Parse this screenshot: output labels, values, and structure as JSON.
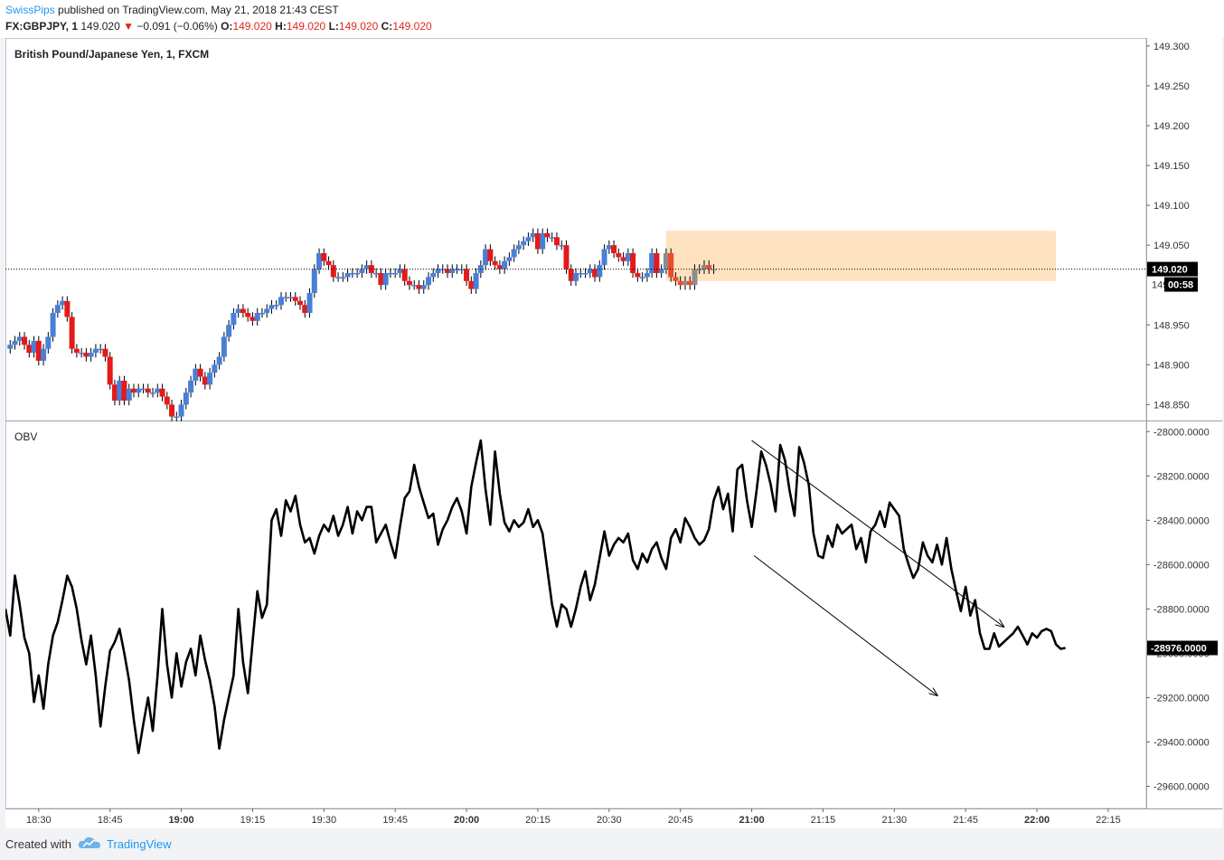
{
  "header": {
    "publisher": "SwissPips",
    "published_text": " published on TradingView.com, May 21, 2018 21:43 CEST",
    "symbol": "FX:GBPJPY, 1",
    "last": "149.020",
    "change": "−0.091 (−0.06%)",
    "o_label": "O:",
    "o_value": "149.020",
    "h_label": "H:",
    "h_value": "149.020",
    "l_label": "L:",
    "l_value": "149.020",
    "c_label": "C:",
    "c_value": "149.020"
  },
  "footer": {
    "created_with": "Created with",
    "brand": "TradingView"
  },
  "colors": {
    "up": "#4a7fd6",
    "down": "#e41a1c",
    "gray": "#8c8c8c",
    "highlight": "#ffe2bf",
    "grid": "#e0e3eb",
    "line": "#000000",
    "price_label_bg": "#000000"
  },
  "chart_data": [
    {
      "type": "candlestick",
      "title": "British Pound/Japanese Yen, 1, FXCM",
      "ylim": [
        148.83,
        149.31
      ],
      "y_ticks": [
        "149.300",
        "149.250",
        "149.200",
        "149.150",
        "149.100",
        "149.050",
        "148.950",
        "148.900",
        "148.850"
      ],
      "y_tick_values": [
        149.3,
        149.25,
        149.2,
        149.15,
        149.1,
        149.05,
        148.95,
        148.9,
        148.85
      ],
      "x_ticks": [
        "18:30",
        "18:45",
        "19:00",
        "19:15",
        "19:30",
        "19:45",
        "20:00",
        "20:15",
        "20:30",
        "20:45",
        "21:00",
        "21:15",
        "21:30",
        "21:45",
        "22:00",
        "22:15"
      ],
      "x_tick_minutes": [
        0,
        15,
        30,
        45,
        60,
        75,
        90,
        105,
        120,
        135,
        150,
        165,
        180,
        195,
        210,
        225
      ],
      "bold_ticks": [
        "19:00",
        "20:00",
        "21:00",
        "22:00"
      ],
      "x_start_minute": -7,
      "x_end_minute": 233,
      "candles_start_minute": -6,
      "current_price": 149.02,
      "current_price_label": "149.020",
      "countdown_label": "00:58",
      "countdown_covered_tick": "149.000",
      "highlight_zone": {
        "from_minute": 132,
        "to_minute": 233,
        "low": 149.005,
        "high": 149.068
      },
      "closes": [
        148.925,
        148.93,
        148.935,
        148.925,
        148.915,
        148.93,
        148.905,
        148.92,
        148.935,
        148.965,
        148.975,
        148.98,
        148.96,
        148.92,
        148.915,
        148.915,
        148.91,
        148.915,
        148.92,
        148.92,
        148.91,
        148.875,
        148.855,
        148.88,
        148.855,
        148.87,
        148.865,
        148.87,
        148.87,
        148.865,
        148.865,
        148.87,
        148.86,
        148.85,
        148.835,
        148.835,
        148.85,
        148.865,
        148.88,
        148.895,
        148.885,
        148.875,
        148.89,
        148.9,
        148.91,
        148.935,
        148.95,
        148.965,
        148.97,
        148.965,
        148.96,
        148.955,
        148.965,
        148.965,
        148.97,
        148.975,
        148.975,
        148.985,
        148.985,
        148.985,
        148.98,
        148.975,
        148.965,
        148.99,
        149.02,
        149.04,
        149.03,
        149.025,
        149.01,
        149.01,
        149.01,
        149.015,
        149.015,
        149.015,
        149.02,
        149.025,
        149.015,
        149.015,
        149.0,
        149.015,
        149.015,
        149.015,
        149.02,
        149.005,
        149.0,
        149.0,
        148.995,
        149.0,
        149.01,
        149.015,
        149.02,
        149.02,
        149.015,
        149.02,
        149.02,
        149.02,
        149.005,
        148.995,
        149.015,
        149.025,
        149.045,
        149.03,
        149.025,
        149.02,
        149.03,
        149.035,
        149.045,
        149.05,
        149.055,
        149.06,
        149.065,
        149.045,
        149.065,
        149.06,
        149.06,
        149.05,
        149.05,
        149.02,
        149.005,
        149.015,
        149.015,
        149.015,
        149.02,
        149.01,
        149.025,
        149.045,
        149.05,
        149.04,
        149.035,
        149.03,
        149.04,
        149.015,
        149.01,
        149.01,
        149.015,
        149.04,
        149.015,
        149.02,
        149.04,
        149.01,
        149.005,
        149.0,
        149.005,
        149.0,
        149.02,
        149.02,
        149.025,
        149.02,
        149.02
      ],
      "trend_lines": [
        {
          "from_minute": 150,
          "to_minute": 205.5,
          "from_value": 149.062,
          "to_value": 149.062,
          "style": "dotted-none"
        }
      ]
    },
    {
      "type": "line",
      "title": "OBV",
      "ylim": [
        -29700,
        -27950
      ],
      "y_ticks": [
        "-28000.0000",
        "-28200.0000",
        "-28400.0000",
        "-28600.0000",
        "-28800.0000",
        "-29000.0000",
        "-29200.0000",
        "-29400.0000",
        "-29600.0000"
      ],
      "y_tick_values": [
        -28000,
        -28200,
        -28400,
        -28600,
        -28800,
        -29000,
        -29200,
        -29400,
        -29600
      ],
      "current_value_label": "-28976.0000",
      "current_value": -28976,
      "obv_start_minute": -7,
      "values": [
        -28800,
        -28920,
        -28650,
        -28780,
        -28930,
        -29000,
        -29220,
        -29100,
        -29250,
        -29050,
        -28920,
        -28860,
        -28760,
        -28650,
        -28700,
        -28800,
        -28940,
        -29050,
        -28920,
        -29100,
        -29330,
        -29150,
        -28990,
        -28950,
        -28890,
        -29000,
        -29120,
        -29300,
        -29450,
        -29320,
        -29200,
        -29350,
        -29100,
        -28800,
        -29050,
        -29200,
        -29000,
        -29150,
        -29040,
        -28980,
        -29100,
        -28920,
        -29030,
        -29120,
        -29240,
        -29430,
        -29300,
        -29200,
        -29100,
        -28800,
        -29040,
        -29180,
        -28950,
        -28720,
        -28840,
        -28780,
        -28400,
        -28350,
        -28470,
        -28310,
        -28360,
        -28290,
        -28420,
        -28500,
        -28480,
        -28550,
        -28470,
        -28420,
        -28450,
        -28380,
        -28470,
        -28420,
        -28340,
        -28460,
        -28360,
        -28400,
        -28340,
        -28340,
        -28500,
        -28460,
        -28420,
        -28500,
        -28570,
        -28430,
        -28300,
        -28270,
        -28150,
        -28250,
        -28320,
        -28390,
        -28370,
        -28510,
        -28440,
        -28400,
        -28340,
        -28300,
        -28360,
        -28460,
        -28250,
        -28140,
        -28040,
        -28260,
        -28420,
        -28090,
        -28280,
        -28410,
        -28450,
        -28400,
        -28430,
        -28410,
        -28350,
        -28430,
        -28400,
        -28460,
        -28620,
        -28780,
        -28880,
        -28780,
        -28800,
        -28880,
        -28800,
        -28700,
        -28630,
        -28760,
        -28690,
        -28570,
        -28450,
        -28560,
        -28510,
        -28480,
        -28500,
        -28460,
        -28580,
        -28620,
        -28550,
        -28590,
        -28530,
        -28500,
        -28570,
        -28620,
        -28480,
        -28440,
        -28500,
        -28390,
        -28430,
        -28480,
        -28510,
        -28490,
        -28440,
        -28310,
        -28250,
        -28350,
        -28280,
        -28450,
        -28170,
        -28150,
        -28310,
        -28430,
        -28270,
        -28090,
        -28150,
        -28240,
        -28360,
        -28060,
        -28130,
        -28270,
        -28380,
        -28070,
        -28140,
        -28240,
        -28460,
        -28560,
        -28570,
        -28470,
        -28520,
        -28420,
        -28460,
        -28440,
        -28420,
        -28530,
        -28480,
        -28590,
        -28450,
        -28420,
        -28360,
        -28430,
        -28320,
        -28350,
        -28380,
        -28530,
        -28600,
        -28660,
        -28620,
        -28500,
        -28560,
        -28590,
        -28510,
        -28600,
        -28480,
        -28620,
        -28720,
        -28810,
        -28700,
        -28830,
        -28760,
        -28910,
        -28980,
        -28980,
        -28910,
        -28970,
        -28950,
        -28930,
        -28910,
        -28880,
        -28920,
        -28960,
        -28910,
        -28930,
        -28900,
        -28890,
        -28900,
        -28960,
        -28980,
        -28976
      ]
    }
  ]
}
